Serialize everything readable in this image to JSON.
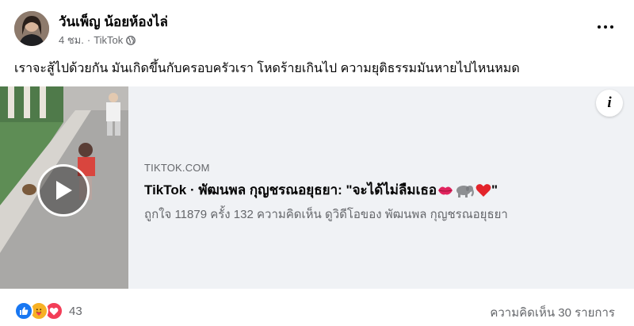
{
  "post": {
    "author": "วันเพ็ญ น้อยห้องไล่",
    "time": "4 ชม.",
    "separator": "·",
    "source": "TikTok",
    "audience_icon": "globe-icon",
    "caption": "เราจะสู้ไปด้วยกัน มันเกิดขึ้นกับครอบครัวเรา โหดร้ายเกินไป ความยุติธรรมมันหายไปไหนหมด"
  },
  "link_preview": {
    "domain": "TIKTOK.COM",
    "title": "TikTok · พัฒนพล กุญชรณอยุธยา: \"จะได้ไม่ลืมเธอ",
    "title_emoji_icons": [
      "kiss-lips-icon",
      "elephant-icon",
      "red-heart-icon"
    ],
    "title_end": "\"",
    "description": "ถูกใจ 11879 ครั้ง 132 ความคิดเห็น ดูวิดีโอของ พัฒนพล กุญชรณอยุธยา",
    "info_label": "i"
  },
  "footer": {
    "reaction_icons": [
      "like-icon",
      "care-icon",
      "love-icon"
    ],
    "reaction_count": "43",
    "comments": "ความคิดเห็น 30 รายการ"
  },
  "colors": {
    "like": "#1877f2",
    "care": "#f7b125",
    "love": "#f33e58",
    "secondary_text": "#65676b",
    "preview_bg": "#f0f2f5"
  }
}
